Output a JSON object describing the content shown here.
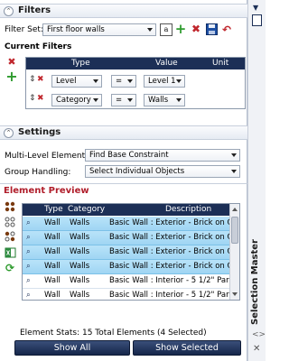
{
  "filters": {
    "title": "Filters",
    "filter_set_label": "Filter Set:",
    "filter_set_value": "First floor walls",
    "current_filters_label": "Current Filters",
    "columns": [
      "Type",
      "Value",
      "Unit"
    ],
    "rows": [
      {
        "type": "Level",
        "op": "=",
        "value": "Level 1"
      },
      {
        "type": "Category",
        "op": "=",
        "value": "Walls"
      }
    ]
  },
  "settings": {
    "title": "Settings",
    "multi_level_label": "Multi-Level Elements:",
    "multi_level_value": "Find Base Constraint",
    "group_label": "Group Handling:",
    "group_value": "Select Individual Objects"
  },
  "preview": {
    "title": "Element Preview",
    "columns": [
      "Type",
      "Category",
      "Description"
    ],
    "rows": [
      {
        "type": "Wall",
        "category": "Walls",
        "description": "Basic Wall : Exterior - Brick on CM",
        "selected": true
      },
      {
        "type": "Wall",
        "category": "Walls",
        "description": "Basic Wall : Exterior - Brick on CM",
        "selected": true
      },
      {
        "type": "Wall",
        "category": "Walls",
        "description": "Basic Wall : Exterior - Brick on CM",
        "selected": true
      },
      {
        "type": "Wall",
        "category": "Walls",
        "description": "Basic Wall : Exterior - Brick on CM",
        "selected": true
      },
      {
        "type": "Wall",
        "category": "Walls",
        "description": "Basic Wall : Interior - 5 1/2\" Partit",
        "selected": false
      },
      {
        "type": "Wall",
        "category": "Walls",
        "description": "Basic Wall : Interior - 5 1/2\" Partit",
        "selected": false
      }
    ],
    "stats": "Element Stats:  15 Total Elements (4 Selected)",
    "show_all": "Show All",
    "show_selected": "Show Selected"
  },
  "side_panel": {
    "title": "Selection Master"
  },
  "colors": {
    "header_dark": "#1c2f56",
    "selected_row": "#aedcf6",
    "accent_red": "#c0272d",
    "accent_green": "#2e9b2e"
  }
}
